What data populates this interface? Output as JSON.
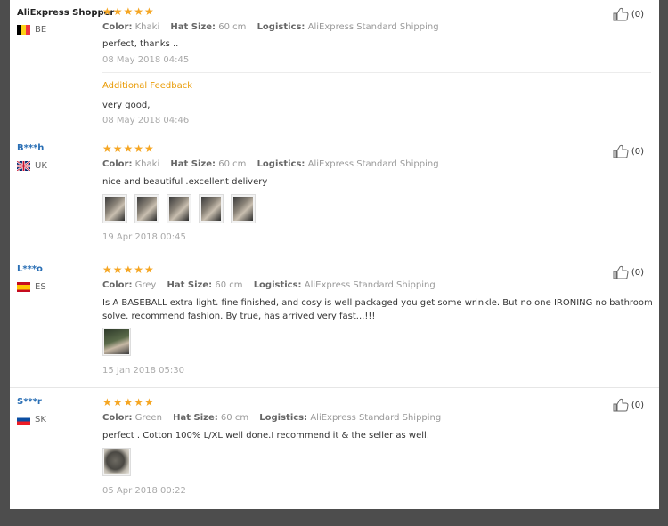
{
  "labels": {
    "color": "Color:",
    "hat_size": "Hat Size:",
    "logistics": "Logistics:",
    "additional_feedback": "Additional Feedback"
  },
  "rating_stars": "★★★★★",
  "reviews": [
    {
      "name": "AliExpress Shopper",
      "country": "BE",
      "flag": "belgium",
      "color": "Khaki",
      "hat_size": "60 cm",
      "logistics": "AliExpress Standard Shipping",
      "text": "perfect, thanks ..",
      "date": "08 May 2018 04:45",
      "additional_text": "very good,",
      "additional_date": "08 May 2018 04:46",
      "likes": "(0)"
    },
    {
      "name": "B***h",
      "country": "UK",
      "flag": "uk",
      "color": "Khaki",
      "hat_size": "60 cm",
      "logistics": "AliExpress Standard Shipping",
      "text": "nice and beautiful .excellent delivery",
      "date": "19 Apr 2018 00:45",
      "likes": "(0)"
    },
    {
      "name": "L***o",
      "country": "ES",
      "flag": "spain",
      "color": "Grey",
      "hat_size": "60 cm",
      "logistics": "AliExpress Standard Shipping",
      "text": "Is A BASEBALL extra light. fine finished, and cosy is well packaged you get some wrinkle. But no one IRONING no bathroom solve. recommend fashion. By true, has arrived very fast...!!!",
      "date": "15 Jan 2018 05:30",
      "likes": "(0)"
    },
    {
      "name": "S***r",
      "country": "SK",
      "flag": "slovakia",
      "color": "Green",
      "hat_size": "60 cm",
      "logistics": "AliExpress Standard Shipping",
      "text": "perfect . Cotton 100% L/XL well done.I recommend it & the seller as well.",
      "date": "05 Apr 2018 00:22",
      "likes": "(0)"
    }
  ],
  "colors": {
    "star": "#f5a623",
    "name_link": "#2a6fb5",
    "additional_feedback": "#e99b06",
    "background": "#4d4d4d"
  },
  "icons": {
    "like": "thumbs-up-icon"
  }
}
